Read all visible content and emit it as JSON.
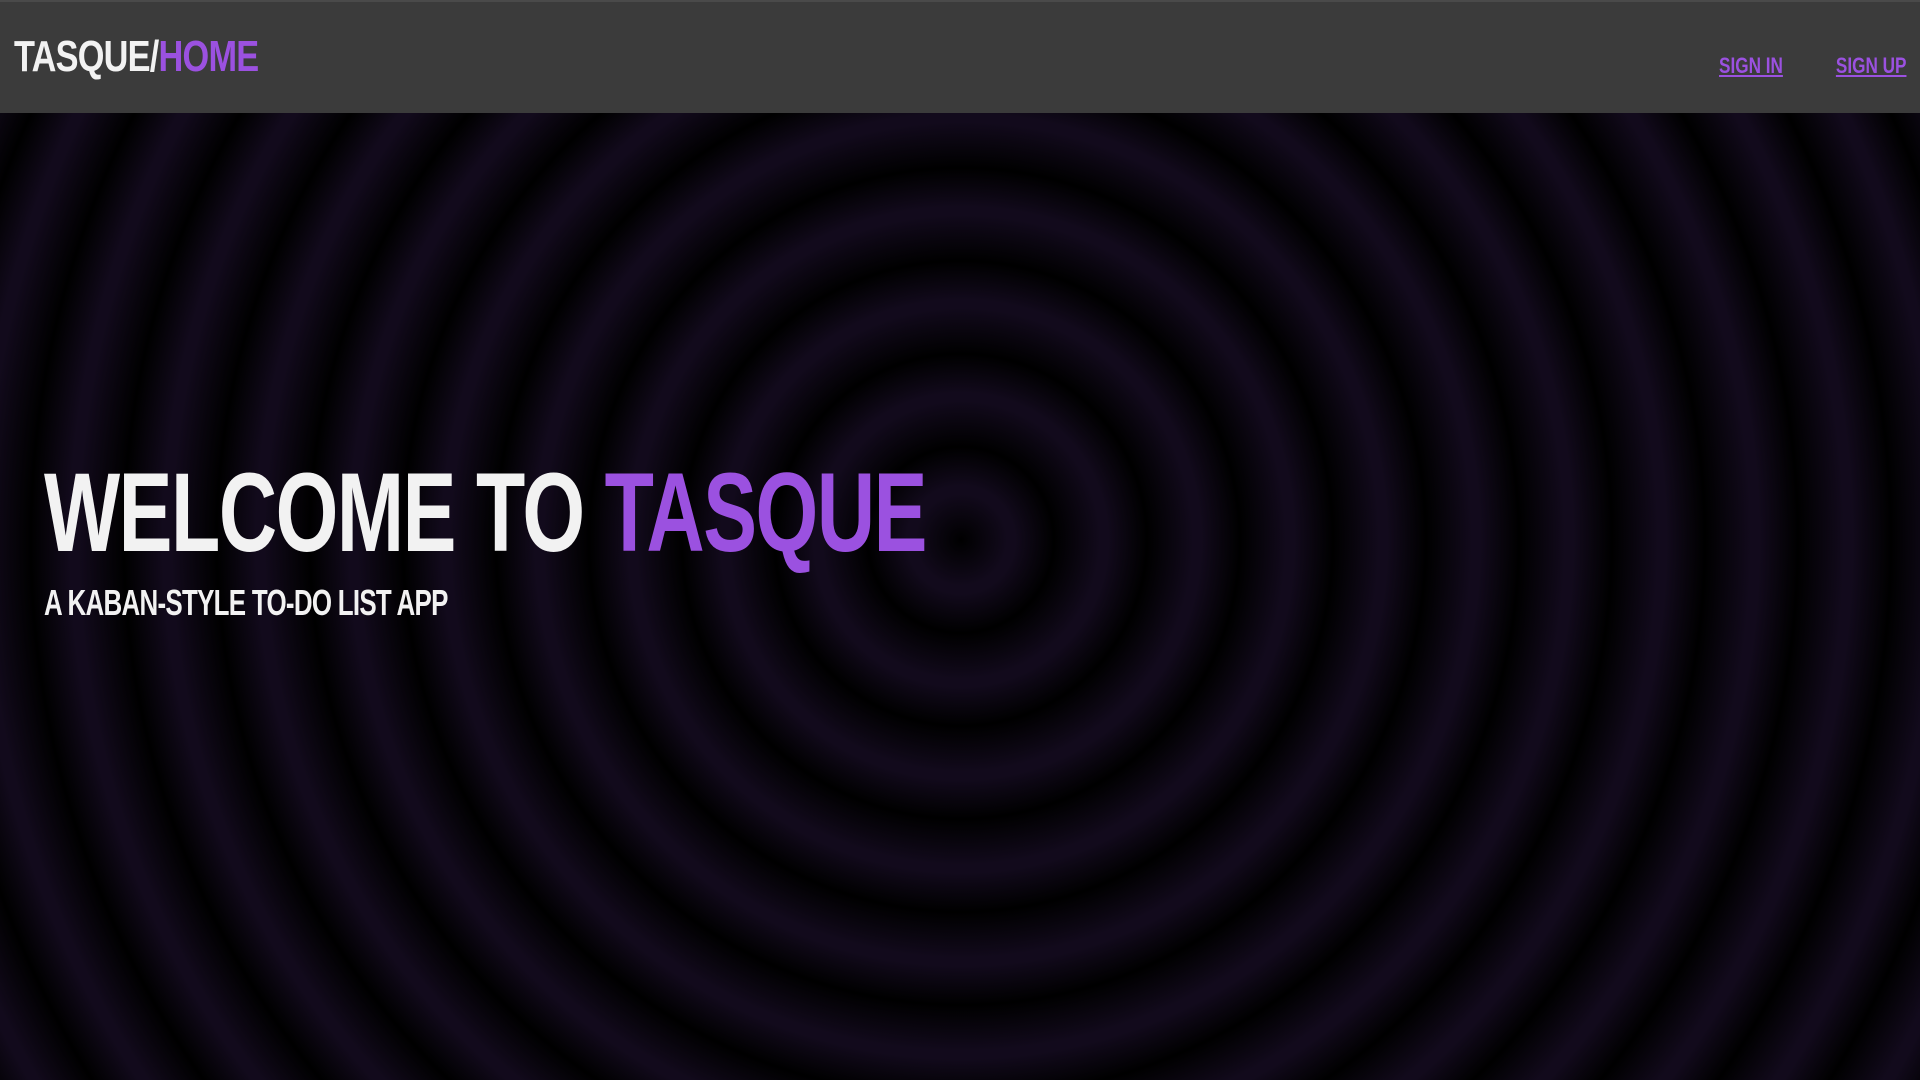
{
  "header": {
    "brand_main": "TASQUE/",
    "brand_accent": "HOME",
    "nav": {
      "sign_in": "SIGN IN",
      "sign_up": "SIGN UP"
    }
  },
  "hero": {
    "title_main": "WELCOME TO ",
    "title_accent": "TASQUE",
    "subtitle": "A KABAN-STYLE TO-DO LIST APP"
  },
  "colors": {
    "accent": "#9b51e0",
    "header_bg": "#3b3b3b",
    "text": "#f2f2f2",
    "background_ring": "#120a1c"
  }
}
